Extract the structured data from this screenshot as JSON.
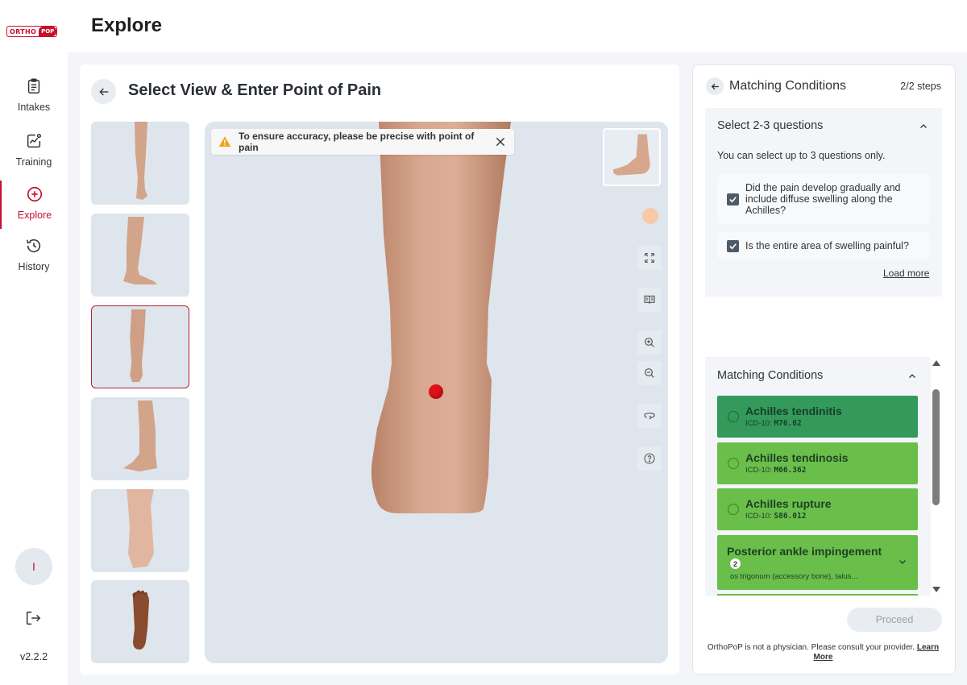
{
  "app": {
    "logo_left": "ORTHO",
    "logo_right": "POP",
    "page_title": "Explore",
    "version": "v2.2.2",
    "avatar_initial": "I"
  },
  "sidebar": {
    "items": [
      {
        "label": "Intakes",
        "icon": "clipboard-icon"
      },
      {
        "label": "Training",
        "icon": "chart-line-icon"
      },
      {
        "label": "Explore",
        "icon": "plus-circle-icon",
        "active": true
      },
      {
        "label": "History",
        "icon": "history-icon"
      }
    ]
  },
  "view": {
    "title": "Select View & Enter Point of Pain",
    "warning": "To ensure accuracy, please be precise with point of pain",
    "thumbnails": [
      "front",
      "lateral",
      "posterior",
      "medial",
      "top",
      "sole"
    ],
    "selected_thumbnail": "posterior"
  },
  "panel": {
    "title": "Matching Conditions",
    "steps": "2/2 steps",
    "questions": {
      "header": "Select 2-3 questions",
      "subtitle": "You can select up to 3 questions only.",
      "items": [
        {
          "text": "Did the pain develop gradually and include diffuse swelling along the Achilles?",
          "checked": true
        },
        {
          "text": "Is the entire area of swelling painful?",
          "checked": true
        }
      ],
      "load_more": "Load more"
    },
    "conditions": {
      "header": "Matching Conditions",
      "items": [
        {
          "name": "Achilles tendinitis",
          "code_label": "ICD-10:",
          "code": "M76.62",
          "selected": true
        },
        {
          "name": "Achilles tendinosis",
          "code_label": "ICD-10:",
          "code": "M66.362",
          "selected": false
        },
        {
          "name": "Achilles rupture",
          "code_label": "ICD-10:",
          "code": "S86.012",
          "selected": false
        },
        {
          "name": "Posterior ankle impingement",
          "count": "2",
          "detail": "os trigonum (accessory bone), talus..."
        }
      ]
    },
    "proceed": "Proceed",
    "disclaimer": "OrthoPoP is not a physician. Please consult your provider.",
    "learn_more": "Learn More"
  },
  "colors": {
    "brand": "#c8102e",
    "selected_condition": "#339a5b",
    "condition": "#6abf4b",
    "pain_point": "#e3101a"
  }
}
